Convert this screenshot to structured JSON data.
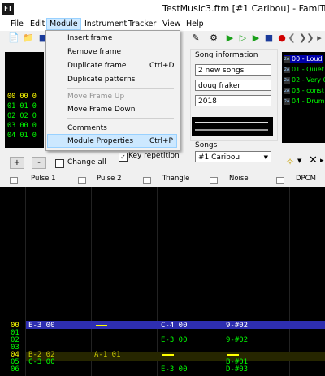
{
  "window": {
    "title": "TestMusic3.ftm [#1 Caribou] - FamiTr",
    "app_icon": "FT"
  },
  "menu": {
    "file": "File",
    "edit": "Edit",
    "module": "Module",
    "instrument": "Instrument",
    "tracker": "Tracker",
    "view": "View",
    "help": "Help"
  },
  "module_menu": {
    "insert_frame": "Insert frame",
    "remove_frame": "Remove frame",
    "duplicate_frame": "Duplicate frame",
    "duplicate_frame_shortcut": "Ctrl+D",
    "duplicate_patterns": "Duplicate patterns",
    "move_frame_up": "Move Frame Up",
    "move_frame_down": "Move Frame Down",
    "comments": "Comments",
    "module_properties": "Module Properties",
    "module_properties_shortcut": "Ctrl+P"
  },
  "frames": {
    "rows": [
      "00 00 0",
      "01 01 0",
      "02 02 0",
      "03 00 0",
      "04 01 0"
    ],
    "add": "+",
    "remove": "-",
    "change_all": "Change all"
  },
  "song_info": {
    "label": "Song information",
    "title": "2 new songs",
    "author": "doug fraker",
    "copyright": "2018",
    "songs_label": "Songs",
    "selected_song": "#1 Caribou"
  },
  "instruments": [
    {
      "num": "00",
      "name": "Loud"
    },
    {
      "num": "01",
      "name": "Quiet"
    },
    {
      "num": "02",
      "name": "Very Q"
    },
    {
      "num": "03",
      "name": "const"
    },
    {
      "num": "04",
      "name": "Drum"
    }
  ],
  "key_repetition": "Key repetition",
  "channels": [
    "Pulse 1",
    "Pulse 2",
    "Triangle",
    "Noise",
    "DPCM"
  ],
  "pattern_rows": [
    {
      "row": "00",
      "p1": "E-3 00",
      "p2": "",
      "tri": "C-4 00",
      "noise": "9-#02"
    },
    {
      "row": "01",
      "p1": "",
      "p2": "",
      "tri": "",
      "noise": ""
    },
    {
      "row": "02",
      "p1": "",
      "p2": "",
      "tri": "E-3 00",
      "noise": "9-#02"
    },
    {
      "row": "03",
      "p1": "",
      "p2": "",
      "tri": "",
      "noise": ""
    },
    {
      "row": "04",
      "p1": "B-2 02",
      "p2": "A-1 01",
      "tri": "",
      "noise": ""
    },
    {
      "row": "05",
      "p1": "C-3 00",
      "p2": "",
      "tri": "",
      "noise": "B-#01"
    },
    {
      "row": "06",
      "p1": "",
      "p2": "",
      "tri": "E-3 00",
      "noise": "D-#03"
    }
  ],
  "colors": {
    "cursor_row": "#2e2eb0",
    "note": "#00ff00",
    "highlight": "#ffff00"
  }
}
